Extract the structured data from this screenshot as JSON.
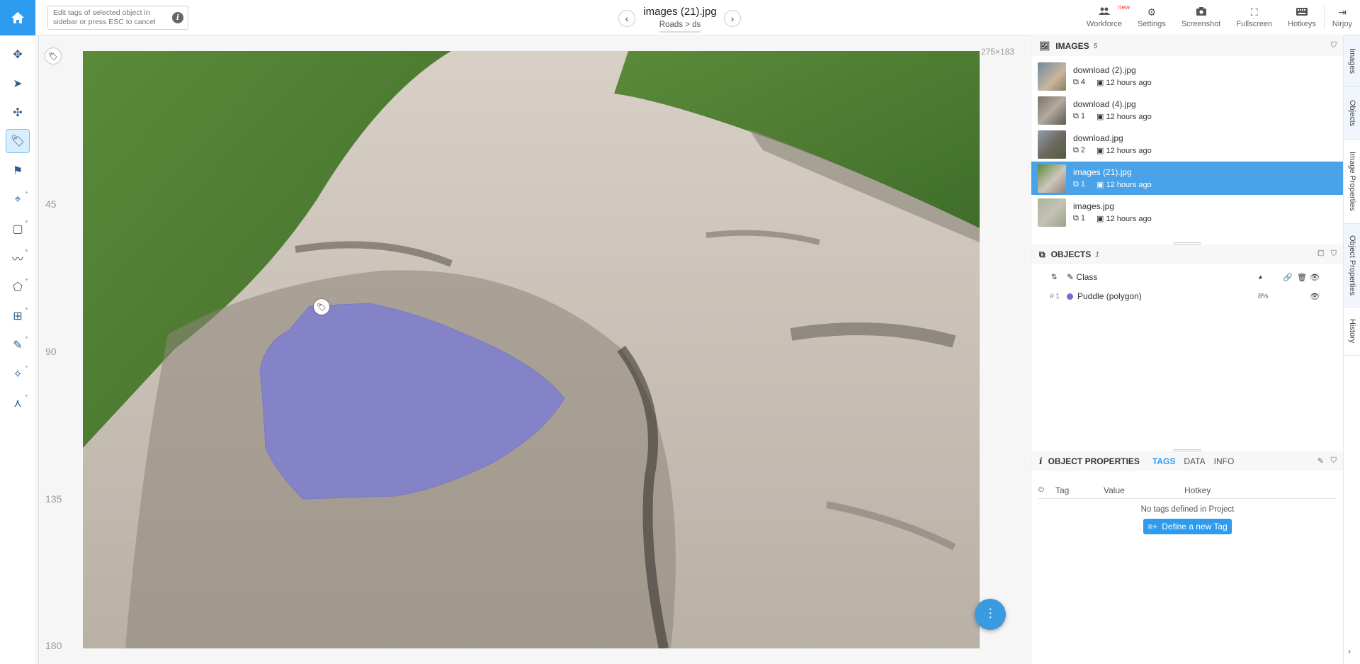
{
  "header": {
    "hint_text": "Edit tags of selected object in sidebar or press ESC to cancel",
    "image_title": "images (21).jpg",
    "breadcrumb": "Roads > ds",
    "actions": [
      {
        "label": "Workforce",
        "icon": "people-icon",
        "badge": "new"
      },
      {
        "label": "Settings",
        "icon": "gear-icon"
      },
      {
        "label": "Screenshot",
        "icon": "camera-icon"
      },
      {
        "label": "Fullscreen",
        "icon": "fullscreen-icon"
      },
      {
        "label": "Hotkeys",
        "icon": "keyboard-icon"
      },
      {
        "label": "Nirjoy",
        "icon": "logout-icon"
      }
    ]
  },
  "toolbar": {
    "tools": [
      "move-tool",
      "select-tool",
      "pan-tool",
      "tag-tool",
      "flag-tool",
      "point-tool",
      "rectangle-tool",
      "polyline-tool",
      "polygon-tool",
      "smart-tool",
      "brush-tool",
      "magic-wand-tool",
      "graph-tool"
    ],
    "active": "tag-tool"
  },
  "canvas": {
    "ruler_labels": [
      "45",
      "90",
      "135",
      "180"
    ],
    "dimensions": "275×183"
  },
  "images_panel": {
    "title": "IMAGES",
    "count": "5",
    "items": [
      {
        "name": "download (2).jpg",
        "objects": "4",
        "time": "12 hours ago"
      },
      {
        "name": "download (4).jpg",
        "objects": "1",
        "time": "12 hours ago"
      },
      {
        "name": "download.jpg",
        "objects": "2",
        "time": "12 hours ago"
      },
      {
        "name": "images (21).jpg",
        "objects": "1",
        "time": "12 hours ago",
        "selected": true
      },
      {
        "name": "images.jpg",
        "objects": "1",
        "time": "12 hours ago"
      }
    ]
  },
  "objects_panel": {
    "title": "OBJECTS",
    "count": "1",
    "column_class": "Class",
    "rows": [
      {
        "index": "# 1",
        "label": "Puddle (polygon)",
        "area": "8%",
        "color": "#6f6fd1"
      }
    ]
  },
  "object_properties": {
    "title": "OBJECT PROPERTIES",
    "tabs": [
      "TAGS",
      "DATA",
      "INFO"
    ],
    "active_tab": "TAGS",
    "columns": [
      "Tag",
      "Value",
      "Hotkey"
    ],
    "empty_text": "No tags defined in Project",
    "define_button": "Define a new Tag"
  },
  "vertical_tabs": [
    "Images",
    "Objects",
    "Image Properties",
    "Object Properties",
    "History"
  ]
}
